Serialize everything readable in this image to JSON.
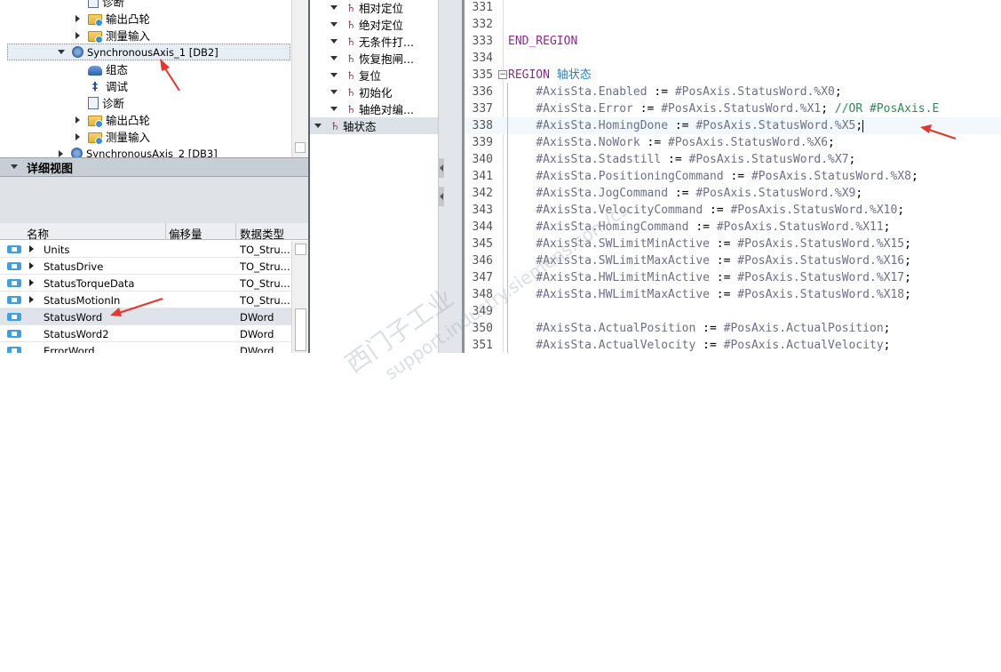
{
  "project_tree": {
    "items": [
      {
        "label": "诊断",
        "icon": "diagnostics-icon",
        "indent": 2,
        "expander": "none"
      },
      {
        "label": "输出凸轮",
        "icon": "folder-icon",
        "indent": 2,
        "expander": "collapsed"
      },
      {
        "label": "测量输入",
        "icon": "folder-icon",
        "indent": 2,
        "expander": "collapsed"
      },
      {
        "label": "SynchronousAxis_1 [DB2]",
        "icon": "axis-icon",
        "indent": 1,
        "expander": "expanded",
        "selected": true
      },
      {
        "label": "组态",
        "icon": "configuration-icon",
        "indent": 2,
        "expander": "none"
      },
      {
        "label": "调试",
        "icon": "commissioning-icon",
        "indent": 2,
        "expander": "none"
      },
      {
        "label": "诊断",
        "icon": "diagnostics-icon",
        "indent": 2,
        "expander": "none"
      },
      {
        "label": "输出凸轮",
        "icon": "folder-icon",
        "indent": 2,
        "expander": "collapsed"
      },
      {
        "label": "测量输入",
        "icon": "folder-icon",
        "indent": 2,
        "expander": "collapsed"
      },
      {
        "label": "SynchronousAxis_2 [DB3]",
        "icon": "axis-icon",
        "indent": 1,
        "expander": "collapsed"
      }
    ]
  },
  "detail_view": {
    "title": "详细视图",
    "columns": [
      "名称",
      "偏移量",
      "数据类型"
    ],
    "rows": [
      {
        "name": "Units",
        "offset": "",
        "type": "TO_Stru...",
        "expandable": true
      },
      {
        "name": "StatusDrive",
        "offset": "",
        "type": "TO_Stru...",
        "expandable": true
      },
      {
        "name": "StatusTorqueData",
        "offset": "",
        "type": "TO_Stru...",
        "expandable": true
      },
      {
        "name": "StatusMotionIn",
        "offset": "",
        "type": "TO_Stru...",
        "expandable": true
      },
      {
        "name": "StatusWord",
        "offset": "",
        "type": "DWord",
        "expandable": false,
        "selected": true
      },
      {
        "name": "StatusWord2",
        "offset": "",
        "type": "DWord",
        "expandable": false
      },
      {
        "name": "ErrorWord",
        "offset": "",
        "type": "DWord",
        "expandable": false
      }
    ]
  },
  "region_list": {
    "items": [
      {
        "label": "相对定位"
      },
      {
        "label": "绝对定位"
      },
      {
        "label": "无条件打..."
      },
      {
        "label": "恢复抱闸..."
      },
      {
        "label": "复位"
      },
      {
        "label": "初始化"
      },
      {
        "label": "轴绝对编..."
      },
      {
        "label": "轴状态",
        "selected": true,
        "top_level": true
      }
    ]
  },
  "code": {
    "lines": [
      {
        "n": "331",
        "text": ""
      },
      {
        "n": "332",
        "text": ""
      },
      {
        "n": "333",
        "text": "END_REGION"
      },
      {
        "n": "334",
        "text": ""
      },
      {
        "n": "335",
        "text": "REGION 轴状态"
      },
      {
        "n": "336",
        "text": "    #AxisSta.Enabled := #PosAxis.StatusWord.%X0;"
      },
      {
        "n": "337",
        "text": "    #AxisSta.Error := #PosAxis.StatusWord.%X1; //OR #PosAxis.E"
      },
      {
        "n": "338",
        "text": "    #AxisSta.HomingDone := #PosAxis.StatusWord.%X5;"
      },
      {
        "n": "339",
        "text": "    #AxisSta.NoWork := #PosAxis.StatusWord.%X6;"
      },
      {
        "n": "340",
        "text": "    #AxisSta.Stadstill := #PosAxis.StatusWord.%X7;"
      },
      {
        "n": "341",
        "text": "    #AxisSta.PositioningCommand := #PosAxis.StatusWord.%X8;"
      },
      {
        "n": "342",
        "text": "    #AxisSta.JogCommand := #PosAxis.StatusWord.%X9;"
      },
      {
        "n": "343",
        "text": "    #AxisSta.VelocityCommand := #PosAxis.StatusWord.%X10;"
      },
      {
        "n": "344",
        "text": "    #AxisSta.HomingCommand := #PosAxis.StatusWord.%X11;"
      },
      {
        "n": "345",
        "text": "    #AxisSta.SWLimitMinActive := #PosAxis.StatusWord.%X15;"
      },
      {
        "n": "346",
        "text": "    #AxisSta.SWLimitMaxActive := #PosAxis.StatusWord.%X16;"
      },
      {
        "n": "347",
        "text": "    #AxisSta.HWLimitMinActive := #PosAxis.StatusWord.%X17;"
      },
      {
        "n": "348",
        "text": "    #AxisSta.HWLimitMaxActive := #PosAxis.StatusWord.%X18;"
      },
      {
        "n": "349",
        "text": ""
      },
      {
        "n": "350",
        "text": "    #AxisSta.ActualPosition := #PosAxis.ActualPosition;"
      },
      {
        "n": "351",
        "text": "    #AxisSta.ActualVelocity := #PosAxis.ActualVelocity;"
      }
    ],
    "highlighted_line": "338"
  },
  "watermark": {
    "line1": "西门子工业",
    "line2": "support.industry.siemens.com/cs"
  },
  "colors": {
    "annotation_arrow": "#e8342a",
    "keyword": "#8a2b8a",
    "comment": "#2e8b57",
    "selection": "#dfe4ea"
  }
}
